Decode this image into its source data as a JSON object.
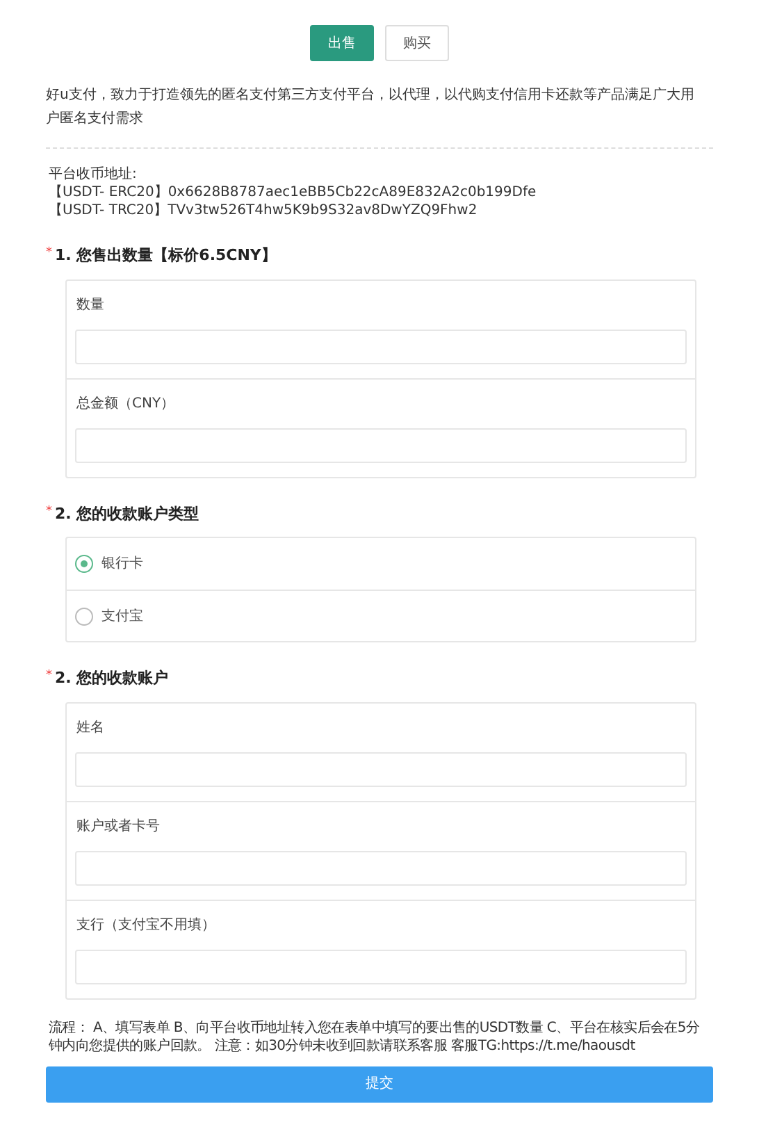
{
  "tabs": [
    {
      "label": "出售",
      "selected": true
    },
    {
      "label": "购买",
      "selected": false
    }
  ],
  "intro": "好u支付，致力于打造领先的匿名支付第三方支付平台，以代理，以代购支付信用卡还款等产品满足广大用户匿名支付需求",
  "addresses": {
    "title": "平台收币地址:",
    "lines": [
      "【USDT- ERC20】0x6628B8787aec1eBB5Cb22cA89E832A2c0b199Dfe",
      "【USDT- TRC20】TVv3tw526T4hw5K9b9S32av8DwYZQ9Fhw2"
    ]
  },
  "sections": [
    {
      "required_mark": "*",
      "title": "1. 您售出数量【标价6.5CNY】",
      "kind": "fields",
      "fields": [
        {
          "label": "数量"
        },
        {
          "label": "总金额（CNY）"
        }
      ]
    },
    {
      "required_mark": "*",
      "title": "2. 您的收款账户类型",
      "kind": "radios",
      "options": [
        {
          "label": "银行卡",
          "selected": true
        },
        {
          "label": "支付宝",
          "selected": false
        }
      ]
    },
    {
      "required_mark": "*",
      "title": "2. 您的收款账户",
      "kind": "fields",
      "fields": [
        {
          "label": "姓名"
        },
        {
          "label": "账户或者卡号"
        },
        {
          "label": "支行（支付宝不用填）"
        }
      ]
    }
  ],
  "notice": "流程： A、填写表单 B、向平台收币地址转入您在表单中填写的要出售的USDT数量 C、平台在核实后会在5分钟内向您提供的账户回款。 注意：如30分钟未收到回款请联系客服 客服TG:https://t.me/haousdt",
  "submit": "提交"
}
